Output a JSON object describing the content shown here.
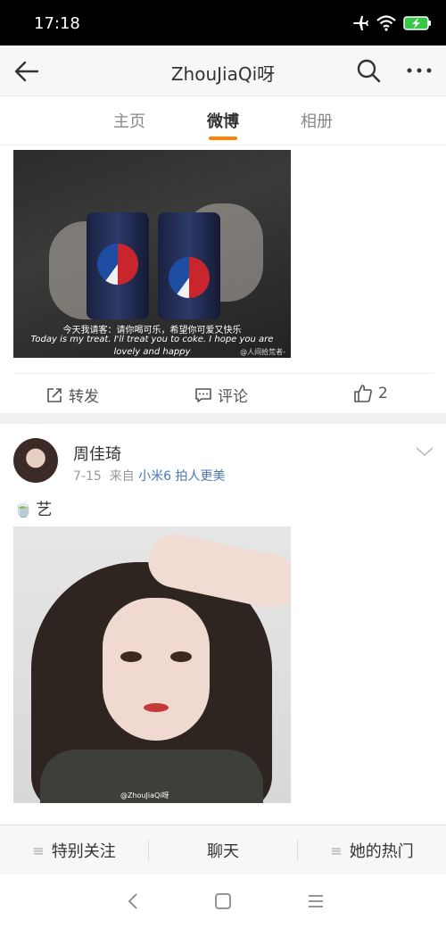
{
  "status_bar": {
    "time": "17:18"
  },
  "nav": {
    "title": "ZhouJiaQi呀"
  },
  "tabs": [
    {
      "label": "主页"
    },
    {
      "label": "微博"
    },
    {
      "label": "相册"
    }
  ],
  "accent_color": "#ff8200",
  "post1": {
    "image_caption_line1": "今天我请客：请你喝可乐，希望你可爱又快乐",
    "image_caption_line2": "Today is my treat. I'll treat you to coke. I hope you are",
    "image_caption_line3": "lovely and happy",
    "image_watermark": "@人间拾荒者-",
    "actions": {
      "repost": "转发",
      "comment": "评论",
      "like_count": "2"
    }
  },
  "post2": {
    "author": "周佳琦",
    "date": "7-15",
    "source_prefix": "来自",
    "source": "小米6 拍人更美",
    "text": "艺",
    "text_emoji": "🍵",
    "image_watermark": "@ZhouJiaQi呀"
  },
  "bottom_bar": {
    "follow": "特别关注",
    "chat": "聊天",
    "hot": "她的热门"
  }
}
